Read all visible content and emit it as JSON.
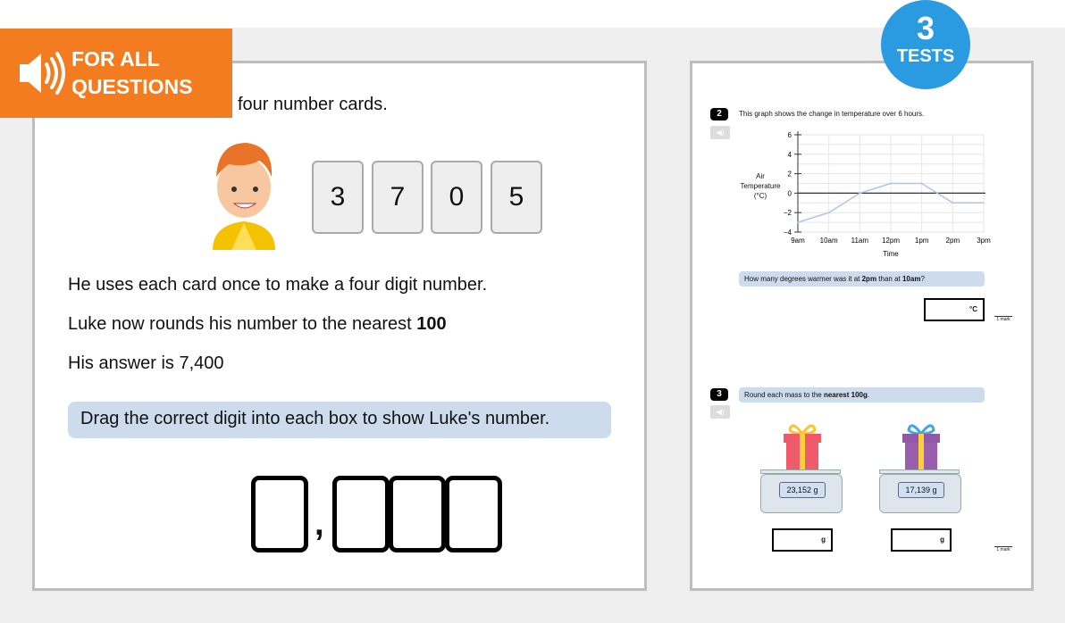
{
  "banner": {
    "label_line1": "FOR ALL",
    "label_line2": "QUESTIONS",
    "icon": "speaker-icon",
    "color": "#f47c20"
  },
  "badge": {
    "number": "3",
    "label": "TESTS",
    "color": "#2a9be0"
  },
  "left": {
    "intro": "four number cards.",
    "cards": [
      "3",
      "7",
      "0",
      "5"
    ],
    "line1": "He uses each card once to make a four digit number.",
    "line2_prefix": "Luke now rounds his number to the nearest ",
    "line2_bold": "100",
    "line3": "His answer is 7,400",
    "instruction": "Drag the correct digit into each box to show Luke's number.",
    "comma": ","
  },
  "right": {
    "q2": {
      "number": "2",
      "text": "This graph shows the change in temperature over 6 hours.",
      "question_prefix": "How many degrees warmer was it at ",
      "q_bold1": "2pm",
      "question_mid": " than at ",
      "q_bold2": "10am",
      "question_suffix": "?",
      "unit": "°C",
      "mark": "1 mark"
    },
    "q3": {
      "number": "3",
      "text_prefix": "Round each mass to the ",
      "text_bold": "nearest 100g",
      "text_suffix": ".",
      "scale1": "23,152 g",
      "scale2": "17,139 g",
      "unit": "g",
      "mark": "1 mark"
    }
  },
  "chart_data": {
    "type": "line",
    "x": [
      "9am",
      "10am",
      "11am",
      "12pm",
      "1pm",
      "2pm",
      "3pm"
    ],
    "series": [
      {
        "values": [
          -3,
          -2,
          0,
          1,
          1,
          -1,
          -1
        ]
      }
    ],
    "ylabel": "Air Temperature (°C)",
    "ylabel_lines": [
      "Air",
      "Temperature",
      "(°C)"
    ],
    "xlabel": "Time",
    "ylim": [
      -4,
      6
    ],
    "yticks": [
      "6",
      "4",
      "2",
      "0",
      "−2",
      "−4"
    ],
    "grid": true,
    "line_color": "#a9c6ea"
  }
}
